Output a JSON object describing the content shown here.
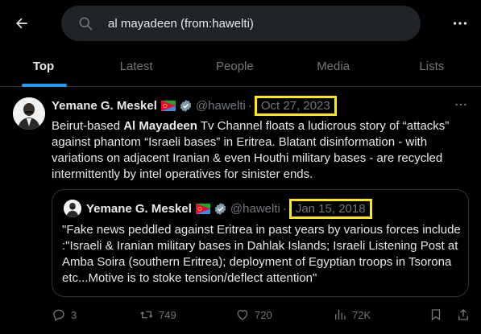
{
  "search": {
    "query": "al mayadeen (from:hawelti)"
  },
  "tabs": [
    {
      "label": "Top"
    },
    {
      "label": "Latest"
    },
    {
      "label": "People"
    },
    {
      "label": "Media"
    },
    {
      "label": "Lists"
    }
  ],
  "tweet": {
    "author_name": "Yemane G. Meskel",
    "handle": "@hawelti",
    "separator": "·",
    "date": "Oct 27, 2023",
    "body_prefix": "Beirut-based ",
    "body_bold": "Al Mayadeen",
    "body_suffix": " Tv Channel floats a ludicrous story of “attacks” against phantom “Israeli bases” in Eritrea. Blatant disinformation - with variations on adjacent Iranian & even Houthi military bases  - are recycled intermittently by intel operatives for sinister ends.",
    "quote": {
      "author_name": "Yemane G. Meskel",
      "handle": "@hawelti",
      "separator": "·",
      "date": "Jan 15, 2018",
      "text": "\"Fake news peddled against Eritrea in past years by various forces include :\"Israeli & Iranian military bases in Dahlak Islands; Israeli Listening Post at Amba Soira (southern Eritrea); deployment of Egyptian troops in Tsorona etc...Motive is to stoke tension/deflect attention\""
    },
    "stats": {
      "replies": "3",
      "reposts": "749",
      "likes": "720",
      "views": "72K"
    }
  },
  "colors": {
    "accent": "#1d9bf0",
    "highlight_box": "#ffea00",
    "muted": "#71767b",
    "background": "#000000"
  },
  "icons": [
    "back-arrow-icon",
    "search-icon",
    "more-icon",
    "flag-icon",
    "verified-icon",
    "reply-icon",
    "repost-icon",
    "like-icon",
    "views-icon",
    "bookmark-icon",
    "share-icon"
  ]
}
